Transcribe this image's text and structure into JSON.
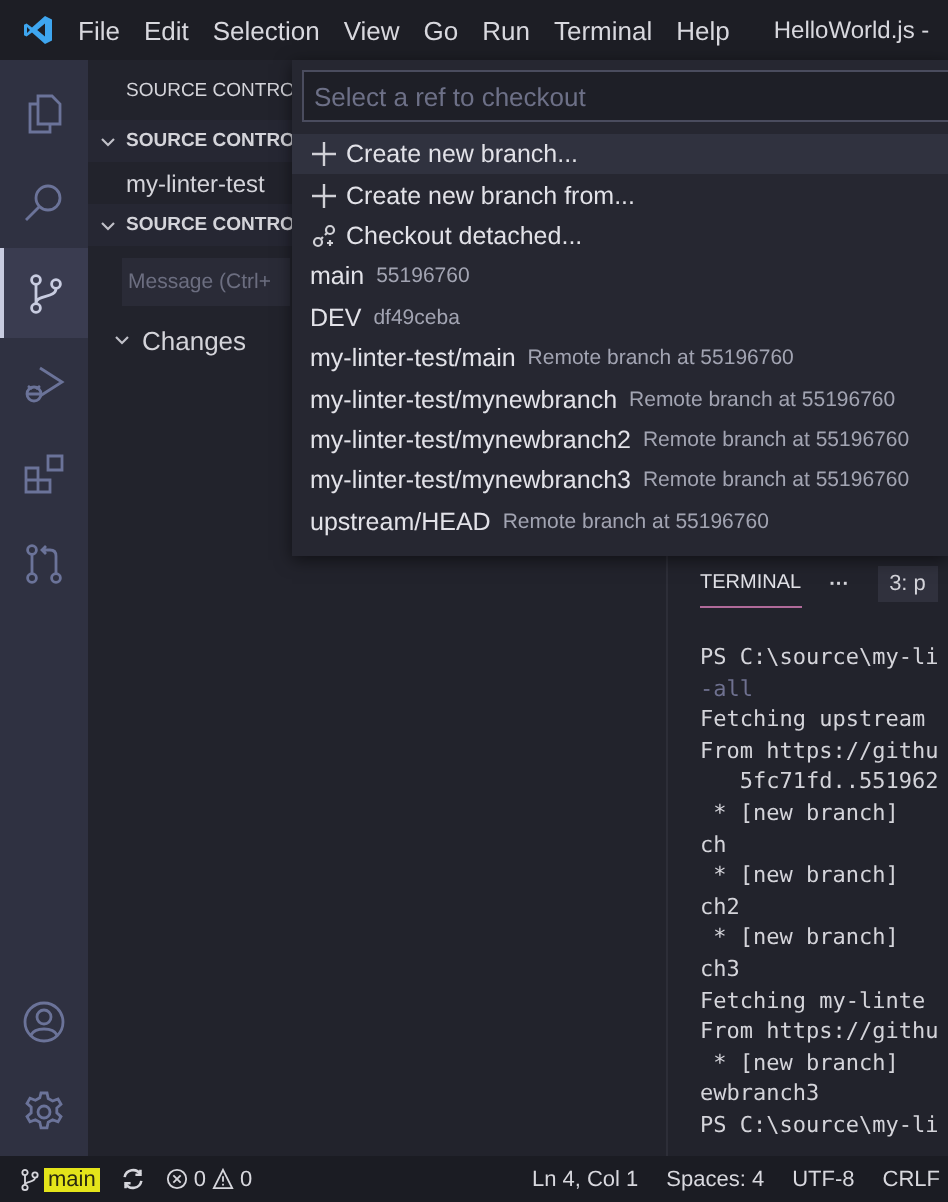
{
  "menu": [
    "File",
    "Edit",
    "Selection",
    "View",
    "Go",
    "Run",
    "Terminal",
    "Help"
  ],
  "window": {
    "title": "HelloWorld.js -"
  },
  "activity_bar": [
    {
      "selected": false
    },
    {
      "selected": false
    },
    {
      "selected": true
    },
    {
      "selected": false
    },
    {
      "selected": false
    },
    {
      "selected": false
    }
  ],
  "sidebar": {
    "title": "SOURCE CONTRO",
    "sections": [
      {
        "title": "SOURCE CONTRO",
        "expanded": true,
        "items": [
          "my-linter-test"
        ]
      },
      {
        "title": "SOURCE CONTRO",
        "expanded": true,
        "message_placeholder": "Message (Ctrl+",
        "groups": [
          {
            "label": "Changes",
            "expanded": true
          }
        ]
      }
    ]
  },
  "quick_pick": {
    "placeholder": "Select a ref to checkout",
    "items": [
      {
        "kind": "create",
        "label": "Create new branch...",
        "selected": true
      },
      {
        "kind": "create",
        "label": "Create new branch from...",
        "selected": false
      },
      {
        "kind": "detach",
        "label": "Checkout detached...",
        "selected": false
      },
      {
        "kind": "ref",
        "label": "main",
        "description": "55196760",
        "selected": false
      },
      {
        "kind": "ref",
        "label": "DEV",
        "description": "df49ceba",
        "selected": false
      },
      {
        "kind": "ref",
        "label": "my-linter-test/main",
        "description": "Remote branch at 55196760",
        "selected": false
      },
      {
        "kind": "ref",
        "label": "my-linter-test/mynewbranch",
        "description": "Remote branch at 55196760",
        "selected": false
      },
      {
        "kind": "ref",
        "label": "my-linter-test/mynewbranch2",
        "description": "Remote branch at 55196760",
        "selected": false
      },
      {
        "kind": "ref",
        "label": "my-linter-test/mynewbranch3",
        "description": "Remote branch at 55196760",
        "selected": false
      },
      {
        "kind": "ref",
        "label": "upstream/HEAD",
        "description": "Remote branch at 55196760",
        "selected": false
      }
    ]
  },
  "panel": {
    "tabs": [
      {
        "label": "TERMINAL",
        "selected": true
      }
    ],
    "more": "···",
    "terminal_picker": "3: p",
    "lines": [
      {
        "text": "PS C:\\source\\my-li",
        "dim": false
      },
      {
        "text": "-all",
        "dim": true
      },
      {
        "text": "Fetching upstream",
        "dim": false
      },
      {
        "text": "From https://githu",
        "dim": false
      },
      {
        "text": "   5fc71fd..551962",
        "dim": false
      },
      {
        "text": " * [new branch]",
        "dim": false
      },
      {
        "text": "ch",
        "dim": false
      },
      {
        "text": " * [new branch]",
        "dim": false
      },
      {
        "text": "ch2",
        "dim": false
      },
      {
        "text": " * [new branch]",
        "dim": false
      },
      {
        "text": "ch3",
        "dim": false
      },
      {
        "text": "Fetching my-linte",
        "dim": false
      },
      {
        "text": "From https://githu",
        "dim": false
      },
      {
        "text": " * [new branch]",
        "dim": false
      },
      {
        "text": "ewbranch3",
        "dim": false
      },
      {
        "text": "PS C:\\source\\my-li",
        "dim": false
      }
    ]
  },
  "status_bar": {
    "branch": "main",
    "errors": "0",
    "warnings": "0",
    "right": [
      "Ln 4, Col 1",
      "Spaces: 4",
      "UTF-8",
      "CRLF"
    ]
  }
}
